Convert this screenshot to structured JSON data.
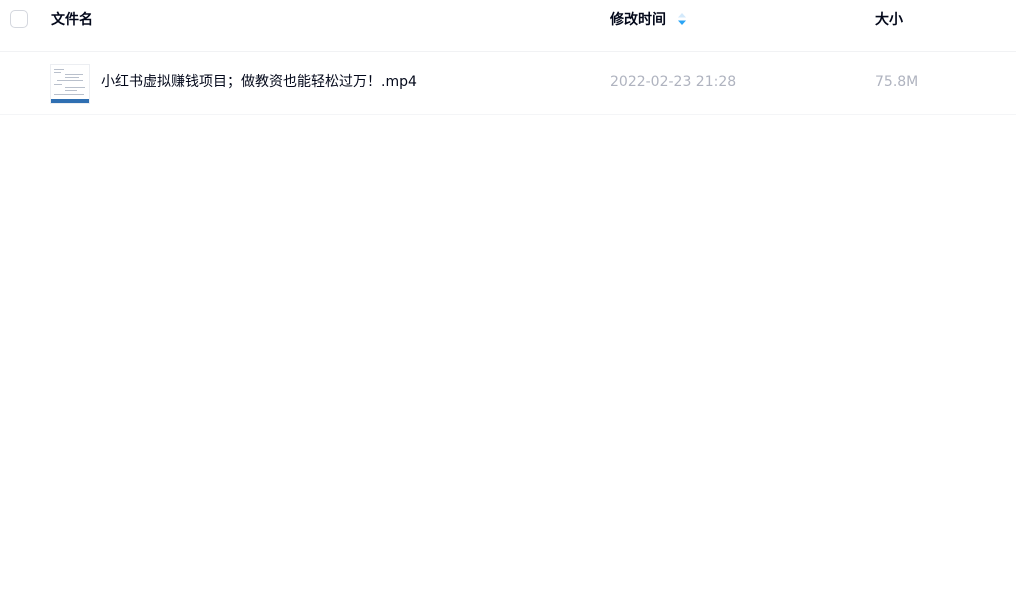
{
  "header": {
    "name_label": "文件名",
    "time_label": "修改时间",
    "size_label": "大小",
    "sort_icon": "sort-icon",
    "accent_color": "#2aa4f5"
  },
  "files": [
    {
      "name": "小红书虚拟赚钱项目；做教资也能轻松过万！.mp4",
      "modified": "2022-02-23 21:28",
      "size": "75.8M",
      "thumbnail_icon": "video-thumbnail-icon"
    }
  ]
}
